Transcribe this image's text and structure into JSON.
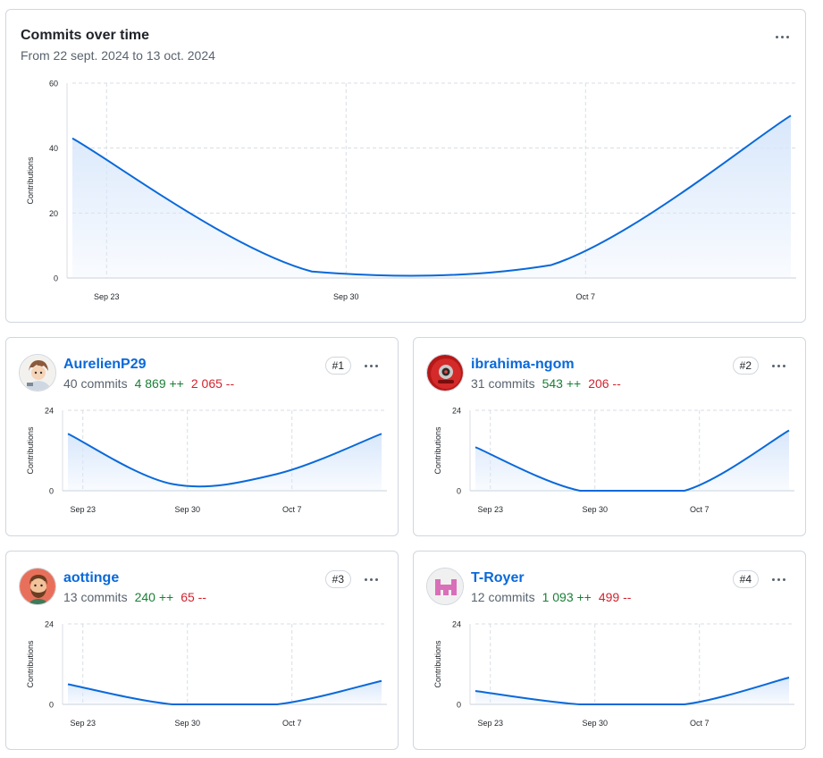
{
  "main": {
    "title": "Commits over time",
    "subtitle": "From 22 sept. 2024 to 13 oct. 2024",
    "menu_icon": "kebab-horizontal-icon"
  },
  "colors": {
    "line": "#0969da",
    "fill": "#d8e7fb",
    "additions": "#1a7f37",
    "deletions": "#d1242f",
    "link": "#0969da",
    "grid": "#d8dee4"
  },
  "chart_data": [
    {
      "type": "area",
      "ylabel": "Contributions",
      "ylim": [
        0,
        60
      ],
      "yticks": [
        "0",
        "20",
        "40",
        "60"
      ],
      "x_ticks": [
        "Sep 23",
        "Sep 30",
        "Oct 7"
      ],
      "x": [
        "2024-09-22",
        "2024-09-29",
        "2024-10-06",
        "2024-10-13"
      ],
      "values": [
        43,
        2,
        4,
        50
      ]
    },
    {
      "type": "area",
      "ylabel": "Contributions",
      "ylim": [
        0,
        24
      ],
      "yticks": [
        "0",
        "24"
      ],
      "x_ticks": [
        "Sep 23",
        "Sep 30",
        "Oct 7"
      ],
      "x": [
        "2024-09-22",
        "2024-09-29",
        "2024-10-06",
        "2024-10-13"
      ],
      "values": [
        17,
        2,
        5,
        17
      ]
    },
    {
      "type": "area",
      "ylabel": "Contributions",
      "ylim": [
        0,
        24
      ],
      "yticks": [
        "0",
        "24"
      ],
      "x_ticks": [
        "Sep 23",
        "Sep 30",
        "Oct 7"
      ],
      "x": [
        "2024-09-22",
        "2024-09-29",
        "2024-10-06",
        "2024-10-13"
      ],
      "values": [
        13,
        0,
        0,
        18
      ]
    },
    {
      "type": "area",
      "ylabel": "Contributions",
      "ylim": [
        0,
        24
      ],
      "yticks": [
        "0",
        "24"
      ],
      "x_ticks": [
        "Sep 23",
        "Sep 30",
        "Oct 7"
      ],
      "x": [
        "2024-09-22",
        "2024-09-29",
        "2024-10-06",
        "2024-10-13"
      ],
      "values": [
        6,
        0,
        0,
        7
      ]
    },
    {
      "type": "area",
      "ylabel": "Contributions",
      "ylim": [
        0,
        24
      ],
      "yticks": [
        "0",
        "24"
      ],
      "x_ticks": [
        "Sep 23",
        "Sep 30",
        "Oct 7"
      ],
      "x": [
        "2024-09-22",
        "2024-09-29",
        "2024-10-06",
        "2024-10-13"
      ],
      "values": [
        4,
        0,
        0,
        8
      ]
    }
  ],
  "contributors": [
    {
      "name": "AurelienP29",
      "commits": "40 commits",
      "additions": "4 869 ++",
      "deletions": "2 065 --",
      "rank": "#1",
      "avatar_icon": "cartoon-character-avatar-icon"
    },
    {
      "name": "ibrahima-ngom",
      "commits": "31 commits",
      "additions": "543 ++",
      "deletions": "206 --",
      "rank": "#2",
      "avatar_icon": "red-robot-avatar-icon"
    },
    {
      "name": "aottinge",
      "commits": "13 commits",
      "additions": "240 ++",
      "deletions": "65 --",
      "rank": "#3",
      "avatar_icon": "bearded-man-avatar-icon"
    },
    {
      "name": "T-Royer",
      "commits": "12 commits",
      "additions": "1 093 ++",
      "deletions": "499 --",
      "rank": "#4",
      "avatar_icon": "pink-identicon-avatar-icon"
    }
  ]
}
